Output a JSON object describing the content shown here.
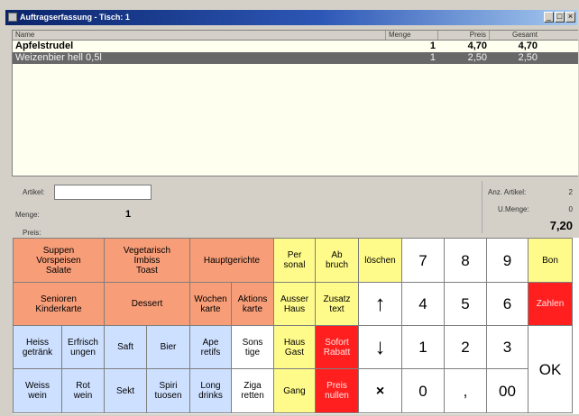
{
  "window": {
    "title": "Auftragserfassung - Tisch: 1"
  },
  "list": {
    "headers": {
      "name": "Name",
      "qty": "Menge",
      "price": "Preis",
      "total": "Gesamt"
    },
    "rows": [
      {
        "name": "Apfelstrudel",
        "qty": "1",
        "price": "4,70",
        "total": "4,70",
        "selected": false
      },
      {
        "name": "Weizenbier hell 0,5l",
        "qty": "1",
        "price": "2,50",
        "total": "2,50",
        "selected": true
      }
    ]
  },
  "info": {
    "artikel_label": "Artikel:",
    "artikel_value": "",
    "menge_label": "Menge:",
    "menge_value": "1",
    "preis_label": "Preis:",
    "anz_artikel_label": "Anz. Artikel:",
    "anz_artikel_value": "2",
    "umenge_label": "U.Menge:",
    "umenge_value": "0",
    "total": "7,20"
  },
  "keys": {
    "suppen": "Suppen\nVorspeisen\nSalate",
    "vegetarisch": "Vegetarisch\nImbiss\nToast",
    "hauptgerichte": "Hauptgerichte",
    "personal": "Per\nsonal",
    "abbruch": "Ab\nbruch",
    "loeschen": "löschen",
    "senioren": "Senioren\nKinderkarte",
    "dessert": "Dessert",
    "wochenkarte": "Wochen\nkarte",
    "aktionskarte": "Aktions\nkarte",
    "ausser_haus": "Ausser\nHaus",
    "zusatztext": "Zusatz\ntext",
    "heissgetraenke": "Heiss\ngetränk",
    "erfrischungen": "Erfrisch\nungen",
    "saft": "Saft",
    "bier": "Bier",
    "aperitifs": "Ape\nretifs",
    "sonstige": "Sons\ntige",
    "haus_gast": "Haus\nGast",
    "sofort_rabatt": "Sofort\nRabatt",
    "weisswein": "Weiss\nwein",
    "rotwein": "Rot\nwein",
    "sekt": "Sekt",
    "spirituosen": "Spiri\ntuosen",
    "long_drinks": "Long\ndrinks",
    "zigaretten": "Ziga\nretten",
    "gang": "Gang",
    "preis_nullen": "Preis\nnullen",
    "n7": "7",
    "n8": "8",
    "n9": "9",
    "n4": "4",
    "n5": "5",
    "n6": "6",
    "n1": "1",
    "n2": "2",
    "n3": "3",
    "n0": "0",
    "comma": ",",
    "n00": "00",
    "bon": "Bon",
    "zahlen": "Zahlen",
    "ok": "OK",
    "up": "↑",
    "down": "↓",
    "clear": "×"
  },
  "colors": {
    "salmon": "#f79d78",
    "yellow": "#fffb8a",
    "red": "#ff1f1f",
    "blue": "#cde0ff",
    "selected_row": "#686868",
    "titlebar": "#0a246a"
  }
}
